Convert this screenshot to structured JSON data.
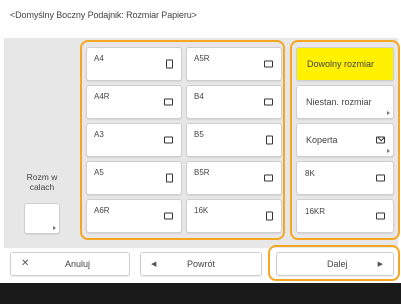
{
  "header": {
    "title": "<Domyślny Boczny Podajnik: Rozmiar Papieru>"
  },
  "side": {
    "label": "Rozm w calach"
  },
  "paper_sizes": [
    {
      "label": "A4",
      "orientation": "portrait"
    },
    {
      "label": "A5R",
      "orientation": "landscape"
    },
    {
      "label": "A4R",
      "orientation": "landscape"
    },
    {
      "label": "B4",
      "orientation": "landscape"
    },
    {
      "label": "A3",
      "orientation": "landscape"
    },
    {
      "label": "B5",
      "orientation": "portrait"
    },
    {
      "label": "A5",
      "orientation": "portrait"
    },
    {
      "label": "B5R",
      "orientation": "landscape"
    },
    {
      "label": "A6R",
      "orientation": "landscape"
    },
    {
      "label": "16K",
      "orientation": "portrait"
    }
  ],
  "right_buttons": [
    {
      "label": "Dowolny rozmiar",
      "selected": true
    },
    {
      "label": "Niestan. rozmiar",
      "selected": false
    },
    {
      "label": "Koperta",
      "selected": false
    },
    {
      "label": "8K",
      "selected": false
    },
    {
      "label": "16KR",
      "selected": false
    }
  ],
  "footer": {
    "cancel_label": "Anuluj",
    "back_label": "Powrót",
    "next_label": "Dalej"
  },
  "colors": {
    "accent_frame": "#f5a623",
    "selected_fill": "#fff100",
    "panel_bg": "#e7e7e7",
    "bottom_bar": "#1a1a1a"
  }
}
